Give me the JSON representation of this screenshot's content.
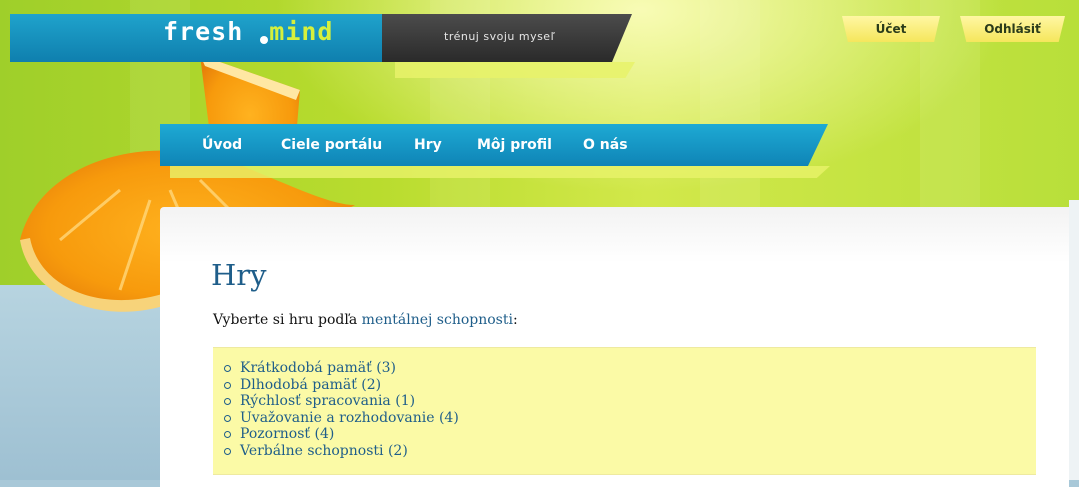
{
  "logo": {
    "part1": "fresh",
    "part2": "mind"
  },
  "tagline": "trénuj svoju myseľ",
  "account": {
    "account_label": "Účet",
    "logout_label": "Odhlásiť"
  },
  "nav": {
    "items": [
      {
        "label": "Úvod"
      },
      {
        "label": "Ciele portálu"
      },
      {
        "label": "Hry"
      },
      {
        "label": "Môj profil"
      },
      {
        "label": "O nás"
      }
    ]
  },
  "main": {
    "title": "Hry",
    "intro_prefix": "Vyberte si hru podľa ",
    "intro_link": "mentálnej schopnosti",
    "intro_suffix": ":",
    "categories": [
      {
        "label": "Krátkodobá pamäť (3)"
      },
      {
        "label": "Dlhodobá pamäť (2)"
      },
      {
        "label": "Rýchlosť spracovania (1)"
      },
      {
        "label": "Uvažovanie a rozhodovanie (4)"
      },
      {
        "label": "Pozornosť (4)"
      },
      {
        "label": "Verbálne schopnosti (2)"
      }
    ]
  },
  "colors": {
    "header_green": "#b9dc2e",
    "logo_blue": "#1fa3cc",
    "nav_blue": "#1eaad4",
    "link_blue": "#1f5e8a",
    "list_highlight": "#fbfaa6",
    "button_yellow": "#f5e65c"
  }
}
